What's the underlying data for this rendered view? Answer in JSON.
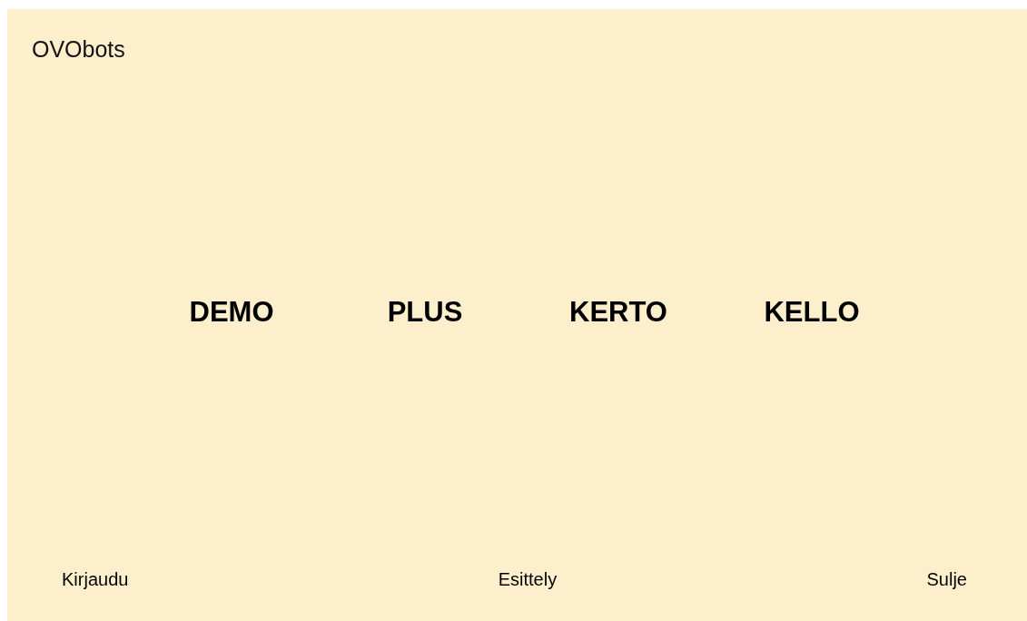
{
  "app_title": "OVObots",
  "modes": [
    {
      "label": "DEMO"
    },
    {
      "label": "PLUS"
    },
    {
      "label": "KERTO"
    },
    {
      "label": "KELLO"
    }
  ],
  "footer_links": [
    "Kirjaudu",
    "Esittely",
    "Sulje"
  ]
}
